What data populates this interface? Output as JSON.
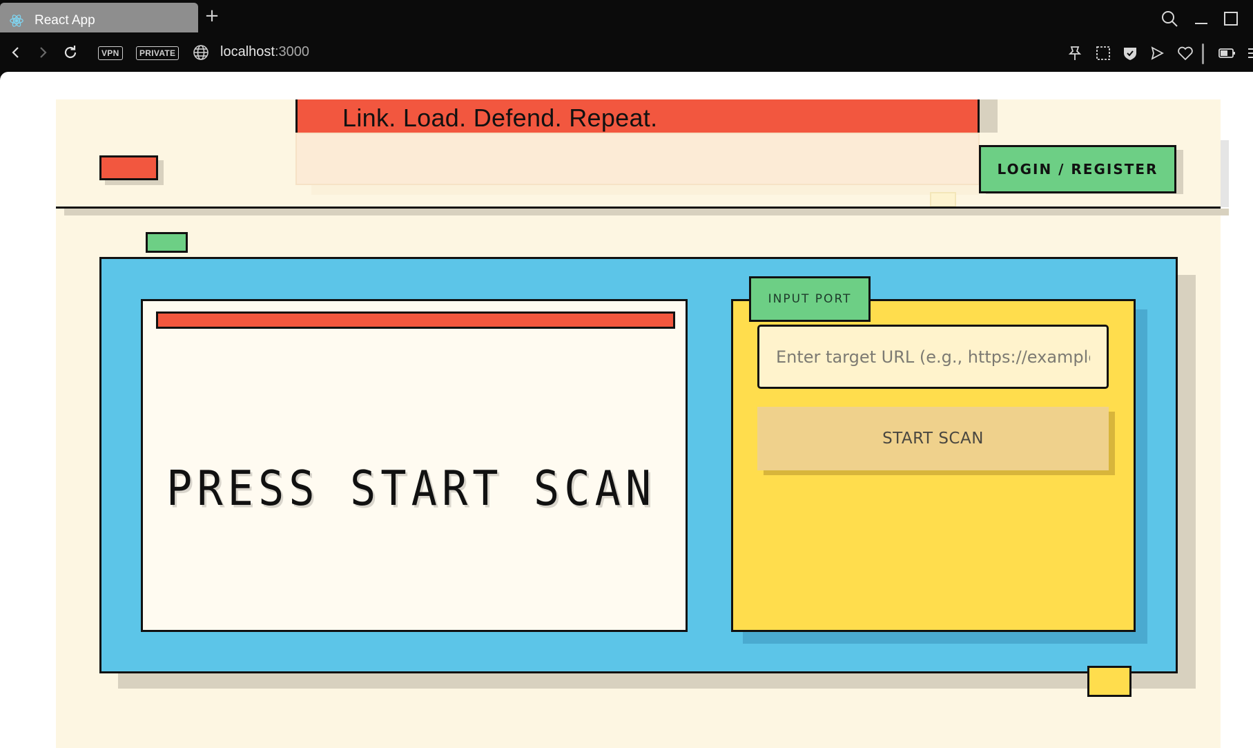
{
  "browser": {
    "tab_title": "React App",
    "new_tab_icon": "plus-icon",
    "url_host": "localhost",
    "url_port": ":3000",
    "badges": {
      "vpn": "VPN",
      "private": "PRIVATE"
    }
  },
  "header": {
    "tagline": "Link. Load. Defend. Repeat.",
    "login_label": "LOGIN / REGISTER"
  },
  "screen": {
    "message": "PRESS START SCAN"
  },
  "input_port": {
    "label": "INPUT PORT",
    "url_placeholder": "Enter target URL (e.g., https://example.com)",
    "url_value": "",
    "scan_label": "START SCAN"
  },
  "colors": {
    "red": "#f2573f",
    "green": "#6dcf85",
    "blue": "#5cc5e8",
    "yellow": "#ffdd4d",
    "cream": "#fdf6e2"
  }
}
